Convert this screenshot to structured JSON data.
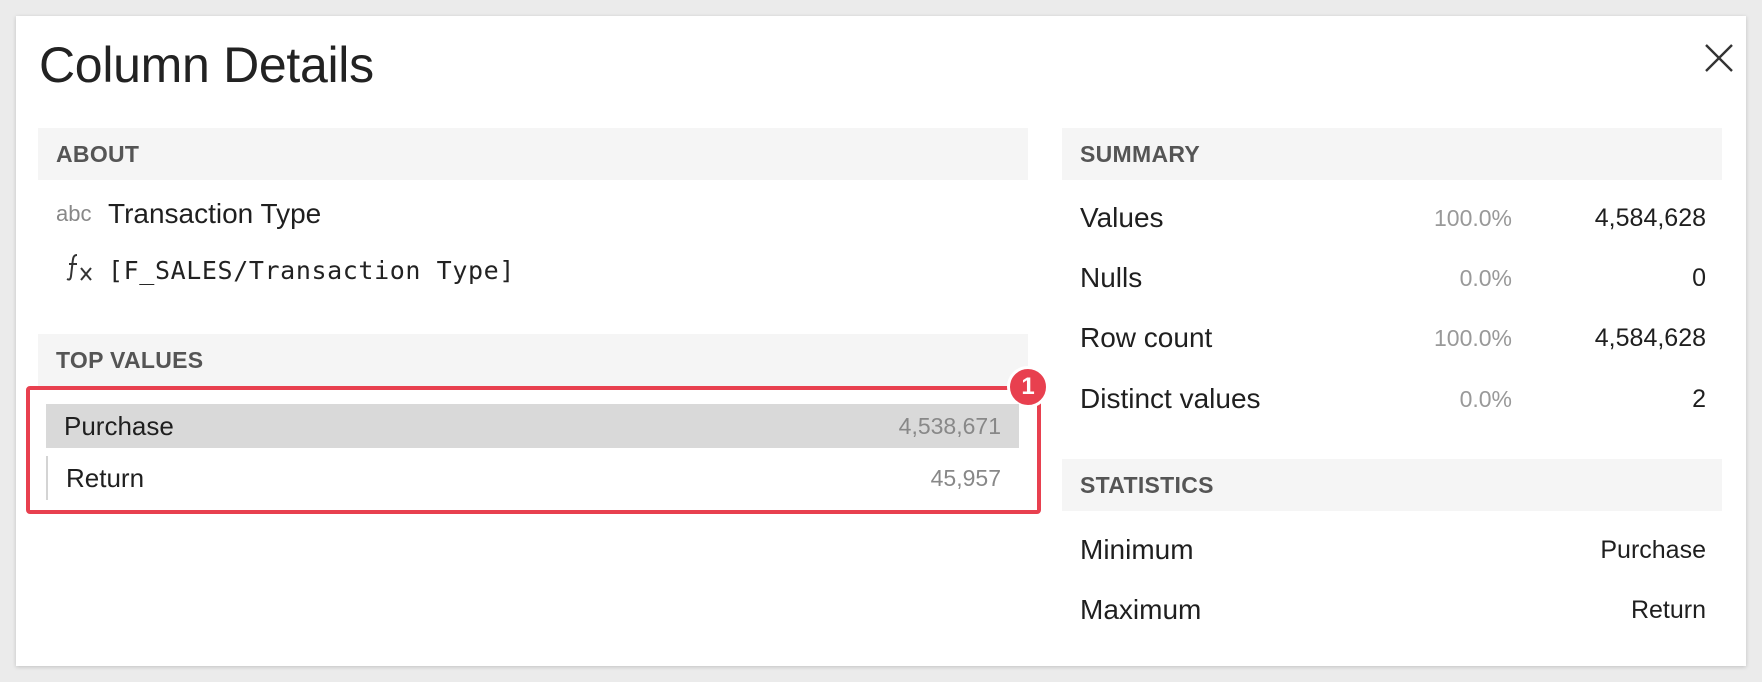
{
  "dialog": {
    "title": "Column Details"
  },
  "about": {
    "header": "ABOUT",
    "type_icon": "abc",
    "column_name": "Transaction Type",
    "formula_icon": "fx-icon",
    "formula": "[F_SALES/Transaction Type]"
  },
  "top_values": {
    "header": "TOP VALUES",
    "badge": "1",
    "items": [
      {
        "label": "Purchase",
        "count": "4,538,671"
      },
      {
        "label": "Return",
        "count": "45,957"
      }
    ]
  },
  "summary": {
    "header": "SUMMARY",
    "rows": [
      {
        "label": "Values",
        "pct": "100.0%",
        "value": "4,584,628"
      },
      {
        "label": "Nulls",
        "pct": "0.0%",
        "value": "0"
      },
      {
        "label": "Row count",
        "pct": "100.0%",
        "value": "4,584,628"
      },
      {
        "label": "Distinct values",
        "pct": "0.0%",
        "value": "2"
      }
    ]
  },
  "statistics": {
    "header": "STATISTICS",
    "rows": [
      {
        "label": "Minimum",
        "value": "Purchase"
      },
      {
        "label": "Maximum",
        "value": "Return"
      }
    ]
  },
  "colors": {
    "accent": "#e8404f",
    "header_bg": "#f5f5f5",
    "selected_row": "#d9d9d9"
  }
}
